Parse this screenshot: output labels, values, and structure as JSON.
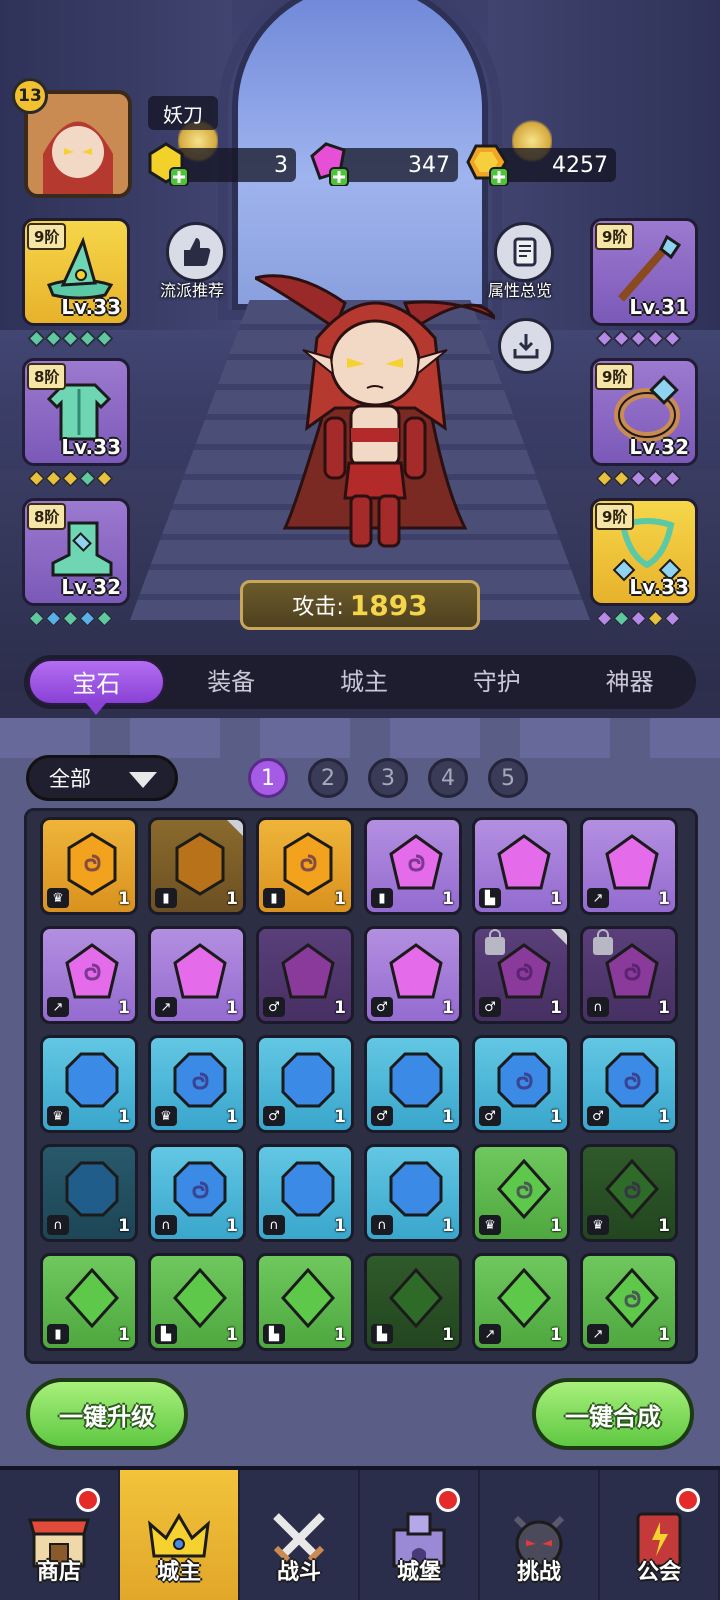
{
  "player": {
    "level": "13",
    "name": "妖刀"
  },
  "resources": {
    "gold_gem": "3",
    "pink_gem": "347",
    "coins": "4257"
  },
  "buttons": {
    "recommend": "流派推荐",
    "overview": "属性总览"
  },
  "equipment": {
    "left": [
      {
        "tier": "9阶",
        "level": "Lv.33",
        "color": "gold",
        "icon": "wizard-hat-icon"
      },
      {
        "tier": "8阶",
        "level": "Lv.33",
        "color": "purple",
        "icon": "robe-icon"
      },
      {
        "tier": "8阶",
        "level": "Lv.32",
        "color": "purple",
        "icon": "boots-icon"
      }
    ],
    "right": [
      {
        "tier": "9阶",
        "level": "Lv.31",
        "color": "purple",
        "icon": "staff-icon"
      },
      {
        "tier": "9阶",
        "level": "Lv.32",
        "color": "purple",
        "icon": "ring-icon"
      },
      {
        "tier": "9阶",
        "level": "Lv.33",
        "color": "gold",
        "icon": "necklace-icon"
      }
    ]
  },
  "attack": {
    "label": "攻击:",
    "value": "1893"
  },
  "tabs": [
    "宝石",
    "装备",
    "城主",
    "守护",
    "神器"
  ],
  "filter": {
    "label": "全部"
  },
  "pages": [
    "1",
    "2",
    "3",
    "4",
    "5"
  ],
  "gems": [
    {
      "c": "c-gold",
      "s": "hex",
      "k": "♛",
      "n": "1",
      "swirl": true
    },
    {
      "c": "c-gold-d",
      "s": "hex",
      "k": "▮",
      "n": "1",
      "swirl": false,
      "corner": true
    },
    {
      "c": "c-gold",
      "s": "hex",
      "k": "▮",
      "n": "1",
      "swirl": true
    },
    {
      "c": "c-purple",
      "s": "pent",
      "k": "▮",
      "n": "1",
      "swirl": true
    },
    {
      "c": "c-purple",
      "s": "pent",
      "k": "▙",
      "n": "1",
      "swirl": false
    },
    {
      "c": "c-purple",
      "s": "pent",
      "k": "↗",
      "n": "1",
      "swirl": false
    },
    {
      "c": "c-purple",
      "s": "pent",
      "k": "↗",
      "n": "1",
      "swirl": true
    },
    {
      "c": "c-purple",
      "s": "pent",
      "k": "↗",
      "n": "1",
      "swirl": false
    },
    {
      "c": "c-purple-d",
      "s": "pent",
      "k": "♂",
      "n": "1",
      "swirl": false
    },
    {
      "c": "c-purple",
      "s": "pent",
      "k": "♂",
      "n": "1",
      "swirl": false
    },
    {
      "c": "c-purple-d",
      "s": "pent",
      "k": "♂",
      "n": "1",
      "swirl": true,
      "lock": true,
      "corner": true
    },
    {
      "c": "c-purple-d",
      "s": "pent",
      "k": "∩",
      "n": "1",
      "swirl": true,
      "lock": true
    },
    {
      "c": "c-blue",
      "s": "oct",
      "k": "♛",
      "n": "1",
      "swirl": false
    },
    {
      "c": "c-blue",
      "s": "oct",
      "k": "♛",
      "n": "1",
      "swirl": true
    },
    {
      "c": "c-blue",
      "s": "oct",
      "k": "♂",
      "n": "1",
      "swirl": false
    },
    {
      "c": "c-blue",
      "s": "oct",
      "k": "♂",
      "n": "1",
      "swirl": false
    },
    {
      "c": "c-blue",
      "s": "oct",
      "k": "♂",
      "n": "1",
      "swirl": true
    },
    {
      "c": "c-blue",
      "s": "oct",
      "k": "♂",
      "n": "1",
      "swirl": true
    },
    {
      "c": "c-blue-d",
      "s": "oct",
      "k": "∩",
      "n": "1",
      "swirl": false
    },
    {
      "c": "c-blue",
      "s": "oct",
      "k": "∩",
      "n": "1",
      "swirl": true
    },
    {
      "c": "c-blue",
      "s": "oct",
      "k": "∩",
      "n": "1",
      "swirl": false
    },
    {
      "c": "c-blue",
      "s": "oct",
      "k": "∩",
      "n": "1",
      "swirl": false
    },
    {
      "c": "c-green",
      "s": "dia",
      "k": "♛",
      "n": "1",
      "swirl": true
    },
    {
      "c": "c-green-d",
      "s": "dia",
      "k": "♛",
      "n": "1",
      "swirl": true
    },
    {
      "c": "c-green",
      "s": "dia",
      "k": "▮",
      "n": "1",
      "swirl": false
    },
    {
      "c": "c-green",
      "s": "dia",
      "k": "▙",
      "n": "1",
      "swirl": false
    },
    {
      "c": "c-green",
      "s": "dia",
      "k": "▙",
      "n": "1",
      "swirl": false
    },
    {
      "c": "c-green-d",
      "s": "dia",
      "k": "▙",
      "n": "1",
      "swirl": false
    },
    {
      "c": "c-green",
      "s": "dia",
      "k": "↗",
      "n": "1",
      "swirl": false
    },
    {
      "c": "c-green",
      "s": "dia",
      "k": "↗",
      "n": "1",
      "swirl": true
    }
  ],
  "actions": {
    "upgrade_all": "一键升级",
    "merge_all": "一键合成"
  },
  "nav": [
    {
      "label": "商店",
      "icon": "shop-icon",
      "dot": true,
      "active": false
    },
    {
      "label": "城主",
      "icon": "crown-icon",
      "dot": false,
      "active": true
    },
    {
      "label": "战斗",
      "icon": "swords-icon",
      "dot": false,
      "active": false
    },
    {
      "label": "城堡",
      "icon": "castle-icon",
      "dot": true,
      "active": false
    },
    {
      "label": "挑战",
      "icon": "demon-icon",
      "dot": false,
      "active": false
    },
    {
      "label": "公会",
      "icon": "guild-book-icon",
      "dot": true,
      "active": false
    }
  ],
  "colors": {
    "accent": "#a55be6",
    "gold": "#f3c12f",
    "green": "#5fc842"
  }
}
